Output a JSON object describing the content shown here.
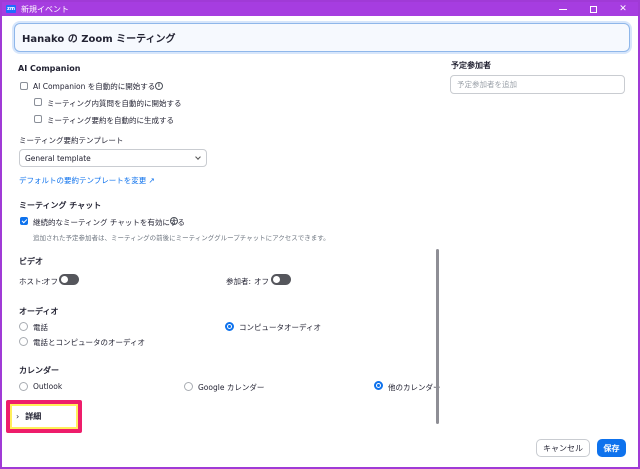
{
  "window": {
    "app_icon": "zm",
    "title": "新規イベント",
    "controls": {
      "minimize": "minimize-icon",
      "maximize": "maximize-icon",
      "close": "✕"
    }
  },
  "topic": {
    "value": "Hanako の Zoom ミーティング"
  },
  "ai_companion": {
    "heading": "AI Companion",
    "auto_start_label": "AI Companion を自動的に開始する",
    "questions_label": "ミーティング内質問を自動的に開始する",
    "summary_label": "ミーティング要約を自動的に生成する",
    "template_label": "ミーティング要約テンプレート",
    "template_value": "General template",
    "change_link": "デフォルトの要約テンプレートを変更 ↗"
  },
  "meeting_chat": {
    "heading": "ミーティング チャット",
    "persistent_label": "継続的なミーティング チャットを有効にする",
    "persistent_checked": true,
    "note": "追加された予定参加者は、ミーティングの前後にミーティンググループチャットにアクセスできます。"
  },
  "video": {
    "heading": "ビデオ",
    "host_label": "ホスト:",
    "host_state": "オフ",
    "participant_label": "参加者:",
    "participant_state": "オフ"
  },
  "audio": {
    "heading": "オーディオ",
    "options": [
      "電話",
      "コンピュータオーディオ",
      "電話とコンピュータのオーディオ"
    ],
    "selected": "コンピュータオーディオ"
  },
  "calendar": {
    "heading": "カレンダー",
    "options": [
      "Outlook",
      "Google カレンダー",
      "他のカレンダー"
    ],
    "selected": "他のカレンダー"
  },
  "details": {
    "arrow": "›",
    "label": "詳細"
  },
  "attendees": {
    "heading": "予定参加者",
    "placeholder": "予定参加者を追加"
  },
  "footer": {
    "cancel_label": "キャンセル",
    "save_label": "保存"
  },
  "colors": {
    "titlebar": "#a63de0",
    "accent": "#0e72ed",
    "highlight_border": "#ee1d6b",
    "highlight_fill": "#ffef5a"
  }
}
